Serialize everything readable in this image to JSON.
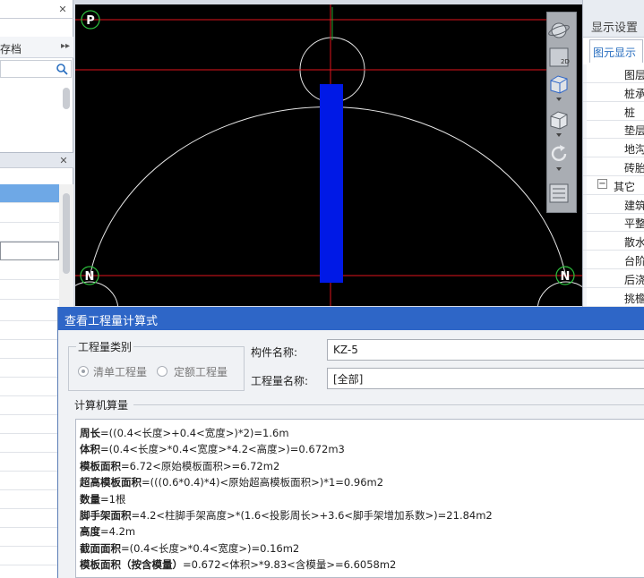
{
  "left_panel": {
    "header_label": "存档",
    "header_arrow": "▸▸",
    "close": "✕"
  },
  "cad": {
    "marker_p": "P",
    "marker_n": "N"
  },
  "right_panel": {
    "title": "显示设置",
    "tab": "图元显示",
    "rows": [
      {
        "label": "图层",
        "indent": 46
      },
      {
        "label": "桩承",
        "indent": 46
      },
      {
        "label": "桩",
        "indent": 46
      },
      {
        "label": "垫层",
        "indent": 46
      },
      {
        "label": "地沟",
        "indent": 46
      },
      {
        "label": "砖胎",
        "indent": 46
      },
      {
        "label": "其它",
        "indent": 34,
        "expander": "−"
      },
      {
        "label": "建筑",
        "indent": 46
      },
      {
        "label": "平整",
        "indent": 46
      },
      {
        "label": "散水",
        "indent": 46
      },
      {
        "label": "台阶",
        "indent": 46
      },
      {
        "label": "后浇",
        "indent": 46
      },
      {
        "label": "挑檐",
        "indent": 46
      }
    ]
  },
  "dialog": {
    "title": "查看工程量计算式",
    "qty_group_label": "工程量类别",
    "radio_list": "清单工程量",
    "radio_quota": "定额工程量",
    "component_name_label": "构件名称:",
    "component_name_value": "KZ-5",
    "quantity_name_label": "工程量名称:",
    "quantity_name_value": "[全部]",
    "calc_label": "计算机算量",
    "formulas": [
      {
        "name": "周长",
        "expr": "=((0.4<长度>+0.4<宽度>)*2)=1.6m"
      },
      {
        "name": "体积",
        "expr": "=(0.4<长度>*0.4<宽度>*4.2<高度>)=0.672m3"
      },
      {
        "name": "模板面积",
        "expr": "=6.72<原始模板面积>=6.72m2"
      },
      {
        "name": "超高模板面积",
        "expr": "=(((0.6*0.4)*4)<原始超高模板面积>)*1=0.96m2"
      },
      {
        "name": "数量",
        "expr": "=1根"
      },
      {
        "name": "脚手架面积",
        "expr": "=4.2<柱脚手架高度>*(1.6<投影周长>+3.6<脚手架增加系数>)=21.84m2"
      },
      {
        "name": "高度",
        "expr": "=4.2m"
      },
      {
        "name": "截面面积",
        "expr": "=(0.4<长度>*0.4<宽度>)=0.16m2"
      },
      {
        "name": "模板面积（按含模量）",
        "expr": "=0.672<体积>*9.83<含模量>=6.6058m2"
      }
    ]
  },
  "colors": {
    "titlebar": "#2e66c7",
    "column": "#0019e6",
    "axis": "#e0151d",
    "selection": "#6ea8e6"
  }
}
